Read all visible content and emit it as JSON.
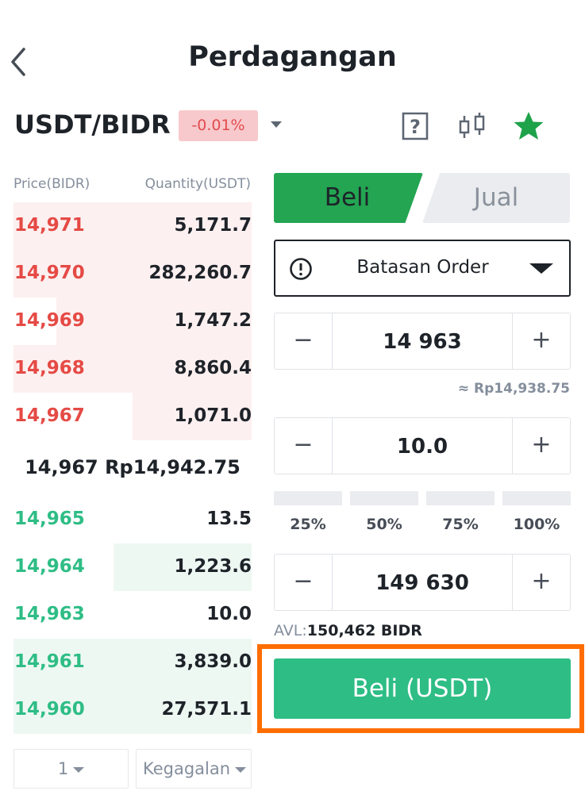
{
  "header": {
    "title": "Perdagangan",
    "back_icon": "chevron-left-icon"
  },
  "pair": {
    "name": "USDT/BIDR",
    "change": "-0.01%"
  },
  "colors": {
    "ask": "#e54a45",
    "bid": "#2ebd85",
    "buy_tab": "#23a552",
    "submit": "#2ebd85",
    "highlight": "#ff6d00"
  },
  "orderbook": {
    "price_header": "Price(BIDR)",
    "qty_header": "Quantity(USDT)",
    "asks": [
      {
        "price": "14,971",
        "qty": "5,171.7",
        "depth": 1.0
      },
      {
        "price": "14,970",
        "qty": "282,260.7",
        "depth": 1.0
      },
      {
        "price": "14,969",
        "qty": "1,747.2",
        "depth": 0.82
      },
      {
        "price": "14,968",
        "qty": "8,860.4",
        "depth": 1.0
      },
      {
        "price": "14,967",
        "qty": "1,071.0",
        "depth": 0.5
      }
    ],
    "last": "14,967 Rp14,942.75",
    "bids": [
      {
        "price": "14,965",
        "qty": "13.5",
        "depth": 0
      },
      {
        "price": "14,964",
        "qty": "1,223.6",
        "depth": 0.58
      },
      {
        "price": "14,963",
        "qty": "10.0",
        "depth": 0
      },
      {
        "price": "14,961",
        "qty": "3,839.0",
        "depth": 1.0
      },
      {
        "price": "14,960",
        "qty": "27,571.1",
        "depth": 1.0
      }
    ],
    "precision": "1",
    "filter": "Kegagalan"
  },
  "trade": {
    "buy_tab": "Beli",
    "sell_tab": "Jual",
    "order_type": "Batasan Order",
    "price_value": "14 963",
    "approx": "≈ Rp14,938.75",
    "amount_value": "10.0",
    "percents": [
      "25%",
      "50%",
      "75%",
      "100%"
    ],
    "total_value": "149 630",
    "avl_label": "AVL:",
    "avl_value": "150,462 BIDR",
    "submit": "Beli (USDT)",
    "minus": "−",
    "plus": "+"
  }
}
